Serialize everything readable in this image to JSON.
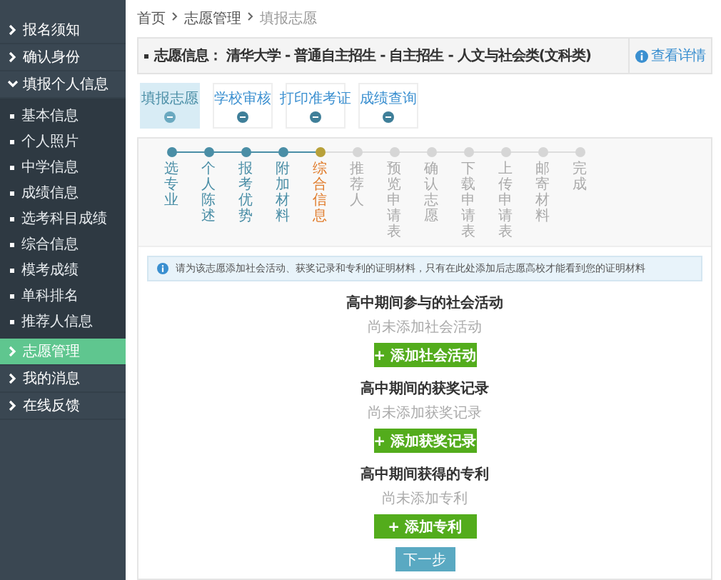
{
  "sidebar": {
    "items": [
      {
        "label": "报名须知",
        "selected": false
      },
      {
        "label": "确认身份",
        "selected": false
      },
      {
        "label": "填报个人信息",
        "selected": false,
        "expanded": true,
        "children": [
          {
            "label": "基本信息",
            "selected": false
          },
          {
            "label": "个人照片",
            "selected": false
          },
          {
            "label": "中学信息",
            "selected": false
          },
          {
            "label": "成绩信息",
            "selected": false
          },
          {
            "label": "选考科目成绩",
            "selected": false
          },
          {
            "label": "综合信息",
            "selected": false
          },
          {
            "label": "模考成绩",
            "selected": false
          },
          {
            "label": "单科排名",
            "selected": false
          },
          {
            "label": "推荐人信息",
            "selected": false
          }
        ]
      },
      {
        "label": "志愿管理",
        "selected": true
      },
      {
        "label": "我的消息",
        "selected": false
      },
      {
        "label": "在线反馈",
        "selected": false
      }
    ]
  },
  "breadcrumb": [
    "首页",
    "志愿管理",
    "填报志愿"
  ],
  "info_bar": {
    "label": "志愿信息：",
    "value": "清华大学 - 普通自主招生 - 自主招生 - 人文与社会类(文科类)",
    "link": "查看详情"
  },
  "tabs": [
    {
      "label": "填报志愿",
      "selected": true
    },
    {
      "label": "学校审核",
      "selected": false
    },
    {
      "label": "打印准考证",
      "selected": false
    },
    {
      "label": "成绩查询",
      "selected": false
    }
  ],
  "steps": [
    {
      "label": "选专业",
      "completed": true,
      "current": false
    },
    {
      "label": "个人陈述",
      "completed": true,
      "current": false
    },
    {
      "label": "报考优势",
      "completed": true,
      "current": false
    },
    {
      "label": "附加材料",
      "completed": true,
      "current": false
    },
    {
      "label": "综合信息",
      "completed": false,
      "current": true
    },
    {
      "label": "推荐人",
      "completed": false,
      "current": false
    },
    {
      "label": "预览申请表",
      "completed": false,
      "current": false
    },
    {
      "label": "确认志愿",
      "completed": false,
      "current": false
    },
    {
      "label": "下载申请表",
      "completed": false,
      "current": false
    },
    {
      "label": "上传申请表",
      "completed": false,
      "current": false
    },
    {
      "label": "邮寄材料",
      "completed": false,
      "current": false
    },
    {
      "label": "完成",
      "completed": false,
      "current": false
    }
  ],
  "notice": "请为该志愿添加社会活动、获奖记录和专利的证明材料，只有在此处添加后志愿高校才能看到您的证明材料",
  "sections": [
    {
      "title": "高中期间参与的社会活动",
      "empty_text": "尚未添加社会活动",
      "button": "+ 添加社会活动"
    },
    {
      "title": "高中期间的获奖记录",
      "empty_text": "尚未添加获奖记录",
      "button": "+ 添加获奖记录"
    },
    {
      "title": "高中期间获得的专利",
      "empty_text": "尚未添加专利",
      "button": "+ 添加专利"
    }
  ],
  "next_button": "下一步"
}
